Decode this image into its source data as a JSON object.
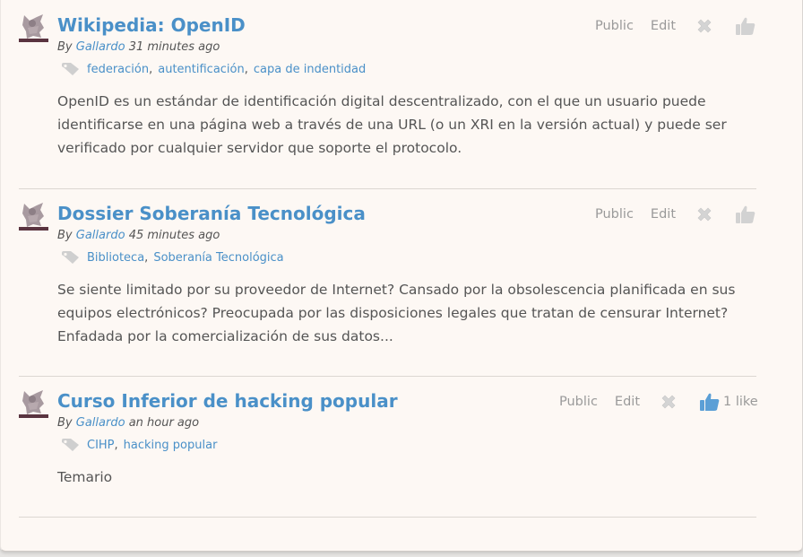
{
  "posts": [
    {
      "title": "Wikipedia: OpenID",
      "by_prefix": "By",
      "author": "Gallardo",
      "time": "31 minutes ago",
      "tags": [
        "federación",
        "autentificación",
        "capa de indentidad"
      ],
      "body": "OpenID es un estándar de identificación digital descentralizado, con el que un usuario puede identificarse en una página web a través de una URL (o un XRI en la versión actual) y puede ser verificado por cualquier servidor que soporte el protocolo.",
      "public_label": "Public",
      "edit_label": "Edit",
      "likes": null,
      "liked": false
    },
    {
      "title": "Dossier Soberanía Tecnológica",
      "by_prefix": "By",
      "author": "Gallardo",
      "time": "45 minutes ago",
      "tags": [
        "Biblioteca",
        "Soberanía Tecnológica"
      ],
      "body": "Se siente limitado por su proveedor de Internet? Cansado por la obsolescencia planificada en sus equipos electrónicos? Preocupada por las disposiciones legales que tratan de censurar Internet? Enfadada por la comercialización de sus datos...",
      "public_label": "Public",
      "edit_label": "Edit",
      "likes": null,
      "liked": false
    },
    {
      "title": "Curso Inferior de hacking popular",
      "by_prefix": "By",
      "author": "Gallardo",
      "time": "an hour ago",
      "tags": [
        "CIHP",
        "hacking popular"
      ],
      "body": "Temario",
      "public_label": "Public",
      "edit_label": "Edit",
      "likes": "1 like",
      "liked": true
    }
  ],
  "icons": {
    "avatar": "user-avatar",
    "tag": "tag-icon",
    "delete": "delete-x-icon",
    "like": "thumbs-up-icon"
  },
  "colors": {
    "link": "#4a90c8",
    "text": "#555555",
    "muted": "#9a9a9a",
    "icon_inactive": "#d2d2d2",
    "background": "#fdf8f4"
  }
}
